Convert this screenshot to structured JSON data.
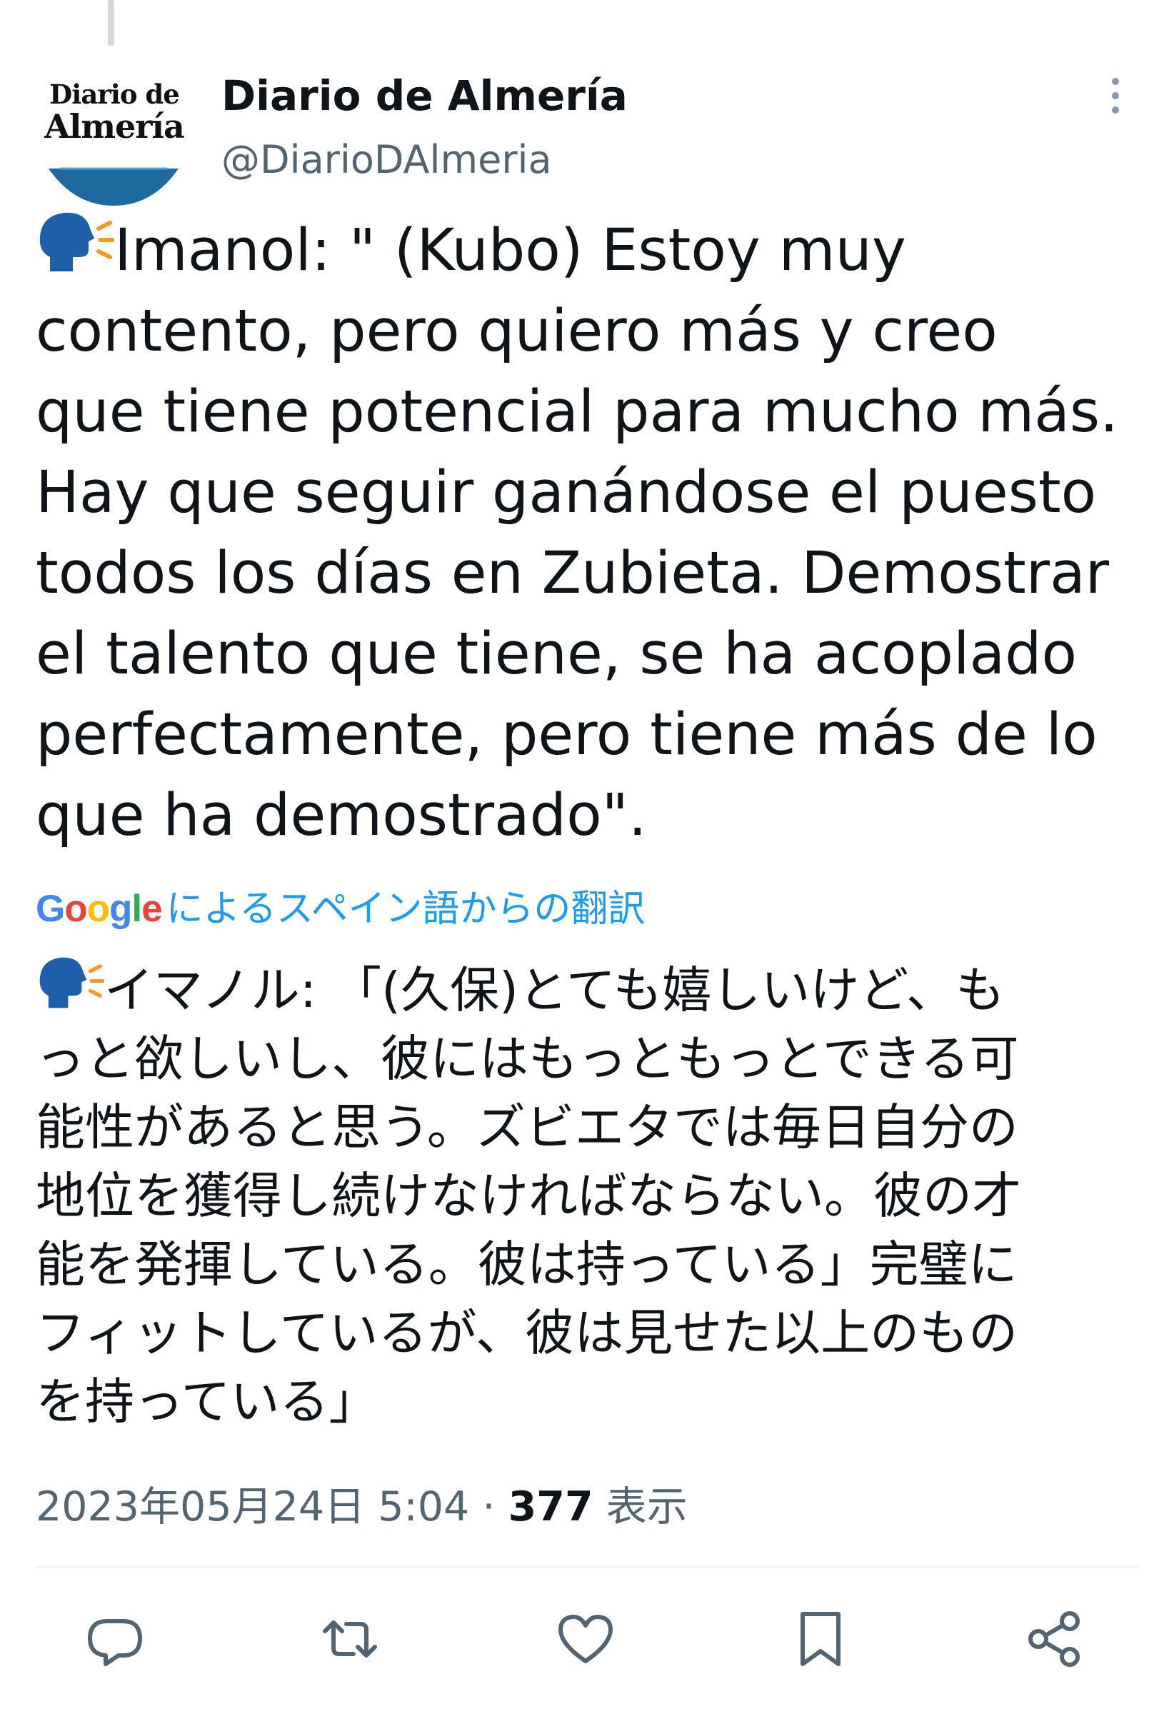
{
  "account": {
    "display_name": "Diario de Almería",
    "handle": "@DiarioDAlmeria",
    "avatar_logo_line1": "Diario de",
    "avatar_logo_line2": "Almería",
    "avatar_icon": "diario-de-almeria-logo"
  },
  "tweet": {
    "emoji": "speaking-head-icon",
    "original_lines": [
      "Imanol: \" (Kubo) Estoy muy",
      "contento, pero quiero más y creo",
      "que tiene potencial para mucho más.",
      "Hay que seguir ganándose el puesto",
      "todos los días en Zubieta. Demostrar",
      "el talento que tiene, se ha acoplado",
      "perfectamente, pero tiene más de lo",
      "que ha demostrado\"."
    ],
    "translation_attribution": {
      "google": [
        "G",
        "o",
        "o",
        "g",
        "l",
        "e"
      ],
      "google_colors": [
        "#4285f4",
        "#ea4335",
        "#fbbc05",
        "#4285f4",
        "#34a853",
        "#ea4335"
      ],
      "text": "によるスペイン語からの翻訳"
    },
    "translated_lines": [
      "イマノル: 「(久保)とても嬉しいけど、も",
      "っと欲しいし、彼にはもっともっとできる可",
      "能性があると思う。ズビエタでは毎日自分の",
      "地位を獲得し続けなければならない。彼の才",
      "能を発揮している。彼は持っている」完璧に",
      "フィットしているが、彼は見せた以上のもの",
      "を持っている」"
    ],
    "timestamp": "2023年05月24日 5:04",
    "separator": "·",
    "views_count": "377",
    "views_label": "表示"
  },
  "actions": [
    {
      "name": "reply-button",
      "icon": "reply-icon"
    },
    {
      "name": "retweet-button",
      "icon": "retweet-icon"
    },
    {
      "name": "like-button",
      "icon": "heart-icon"
    },
    {
      "name": "bookmark-button",
      "icon": "bookmark-icon"
    },
    {
      "name": "share-button",
      "icon": "share-icon"
    }
  ],
  "colors": {
    "text_primary": "#0f1419",
    "text_secondary": "#536471",
    "link_blue": "#1d9bf0",
    "logo_blue": "#1e6aa0",
    "icon_gray": "#536471"
  }
}
